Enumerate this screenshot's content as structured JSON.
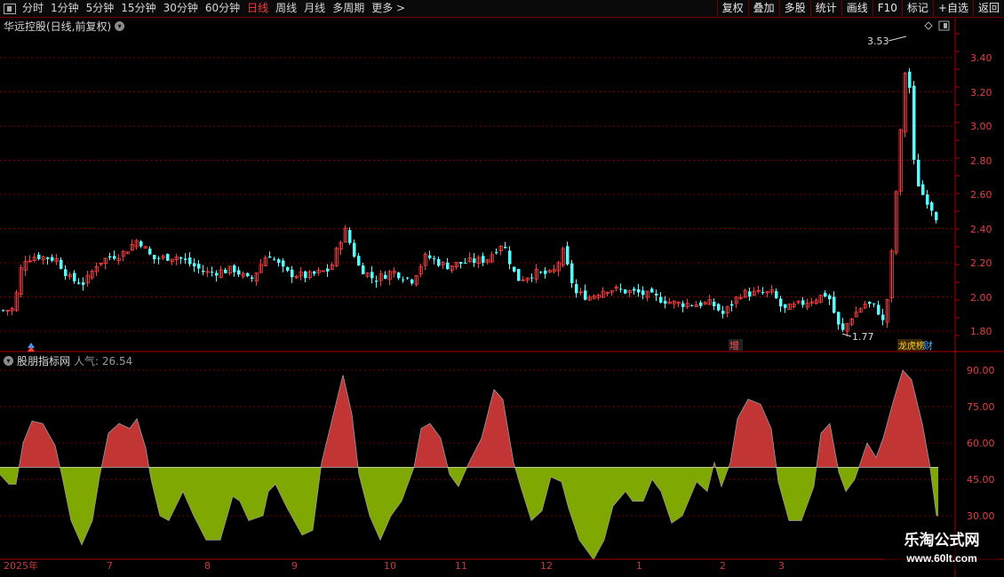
{
  "topbar": {
    "periods": [
      "分时",
      "1分钟",
      "5分钟",
      "15分钟",
      "30分钟",
      "60分钟",
      "日线",
      "周线",
      "月线",
      "多周期",
      "更多 >"
    ],
    "active_period": "日线",
    "buttons": [
      "复权",
      "叠加",
      "多股",
      "统计",
      "画线",
      "F10",
      "标记",
      "+自选",
      "返回"
    ]
  },
  "chart": {
    "title": "华远控股(日线,前复权)",
    "price_ticks": [
      "3.40",
      "3.20",
      "3.00",
      "2.80",
      "2.60",
      "2.40",
      "2.20",
      "2.00",
      "1.80"
    ],
    "high_label": "3.53",
    "low_label": "1.77",
    "markers": [
      "增",
      "龙虎榜",
      "财"
    ],
    "colors": {
      "up": "#ff3c3c",
      "down": "#54ffff",
      "grid": "#7a0000",
      "axis": "#b00000"
    }
  },
  "indicator": {
    "title": "股朋指标网",
    "label": "人气: 26.54",
    "ticks": [
      "90.00",
      "75.00",
      "60.00",
      "45.00",
      "30.00"
    ],
    "colors": {
      "above": "#c23535",
      "below": "#7fa800"
    }
  },
  "dates": [
    "2025年",
    "7",
    "8",
    "9",
    "10",
    "11",
    "12",
    "1",
    "2",
    "3"
  ],
  "watermark": {
    "title": "乐淘公式网",
    "url": "www.60lt.com"
  }
}
